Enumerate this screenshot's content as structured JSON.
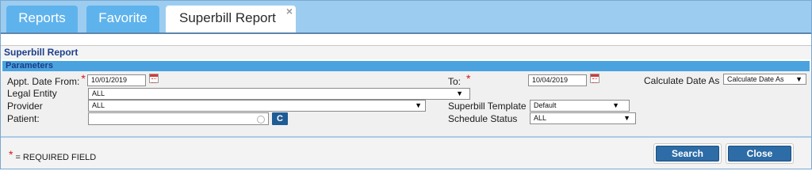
{
  "tabs": [
    {
      "label": "Reports",
      "active": false
    },
    {
      "label": "Favorite",
      "active": false
    },
    {
      "label": "Superbill Report",
      "active": true,
      "close_icon": "×"
    }
  ],
  "page_title": "Superbill Report",
  "section_title": "Parameters",
  "form": {
    "appt_from_label": "Appt. Date From:",
    "appt_from_value": "10/01/2019",
    "to_label": "To:",
    "to_value": "10/04/2019",
    "calc_date_label": "Calculate Date As",
    "calc_date_value": "Calculate Date As",
    "legal_entity_label": "Legal Entity",
    "legal_entity_value": "ALL",
    "provider_label": "Provider",
    "provider_value": "ALL",
    "superbill_template_label": "Superbill Template",
    "superbill_template_value": "Default",
    "patient_label": "Patient:",
    "patient_value": "",
    "patient_clear_label": "C",
    "schedule_status_label": "Schedule Status",
    "schedule_status_value": "ALL",
    "required_marker": "*",
    "dropdown_arrow": "▼"
  },
  "footer": {
    "required_note": "= REQUIRED FIELD",
    "search_label": "Search",
    "close_label": "Close"
  },
  "colors": {
    "tab_inactive": "#5fb3ec",
    "tabbar_bg": "#9ccdf0",
    "section_header": "#4aa3df",
    "button_blue": "#2d6ca6",
    "required_red": "#d51818"
  }
}
